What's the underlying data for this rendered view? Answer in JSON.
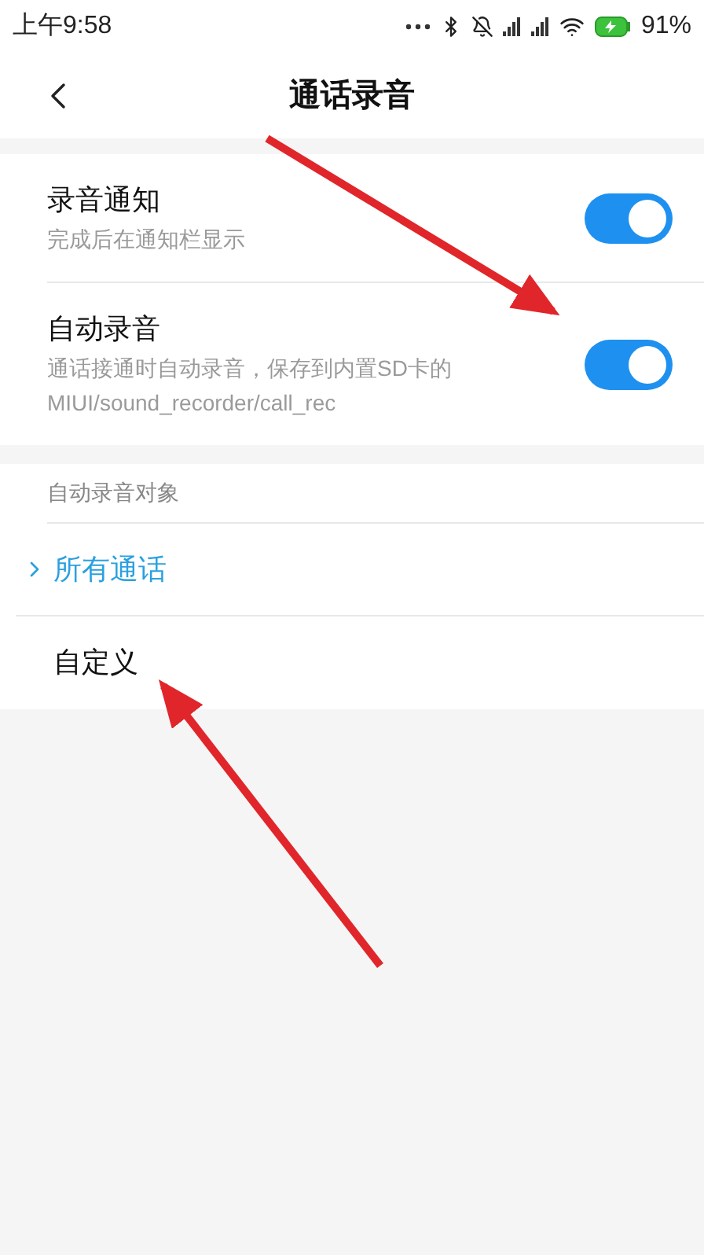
{
  "status_bar": {
    "time": "上午9:58",
    "battery": "91%"
  },
  "header": {
    "title": "通话录音"
  },
  "settings": [
    {
      "title": "录音通知",
      "subtitle": "完成后在通知栏显示",
      "on": true
    },
    {
      "title": "自动录音",
      "subtitle": "通话接通时自动录音，保存到内置SD卡的MIUI/sound_recorder/call_rec",
      "on": true
    }
  ],
  "targets": {
    "heading": "自动录音对象",
    "options": [
      {
        "label": "所有通话",
        "selected": true
      },
      {
        "label": "自定义",
        "selected": false
      }
    ]
  }
}
